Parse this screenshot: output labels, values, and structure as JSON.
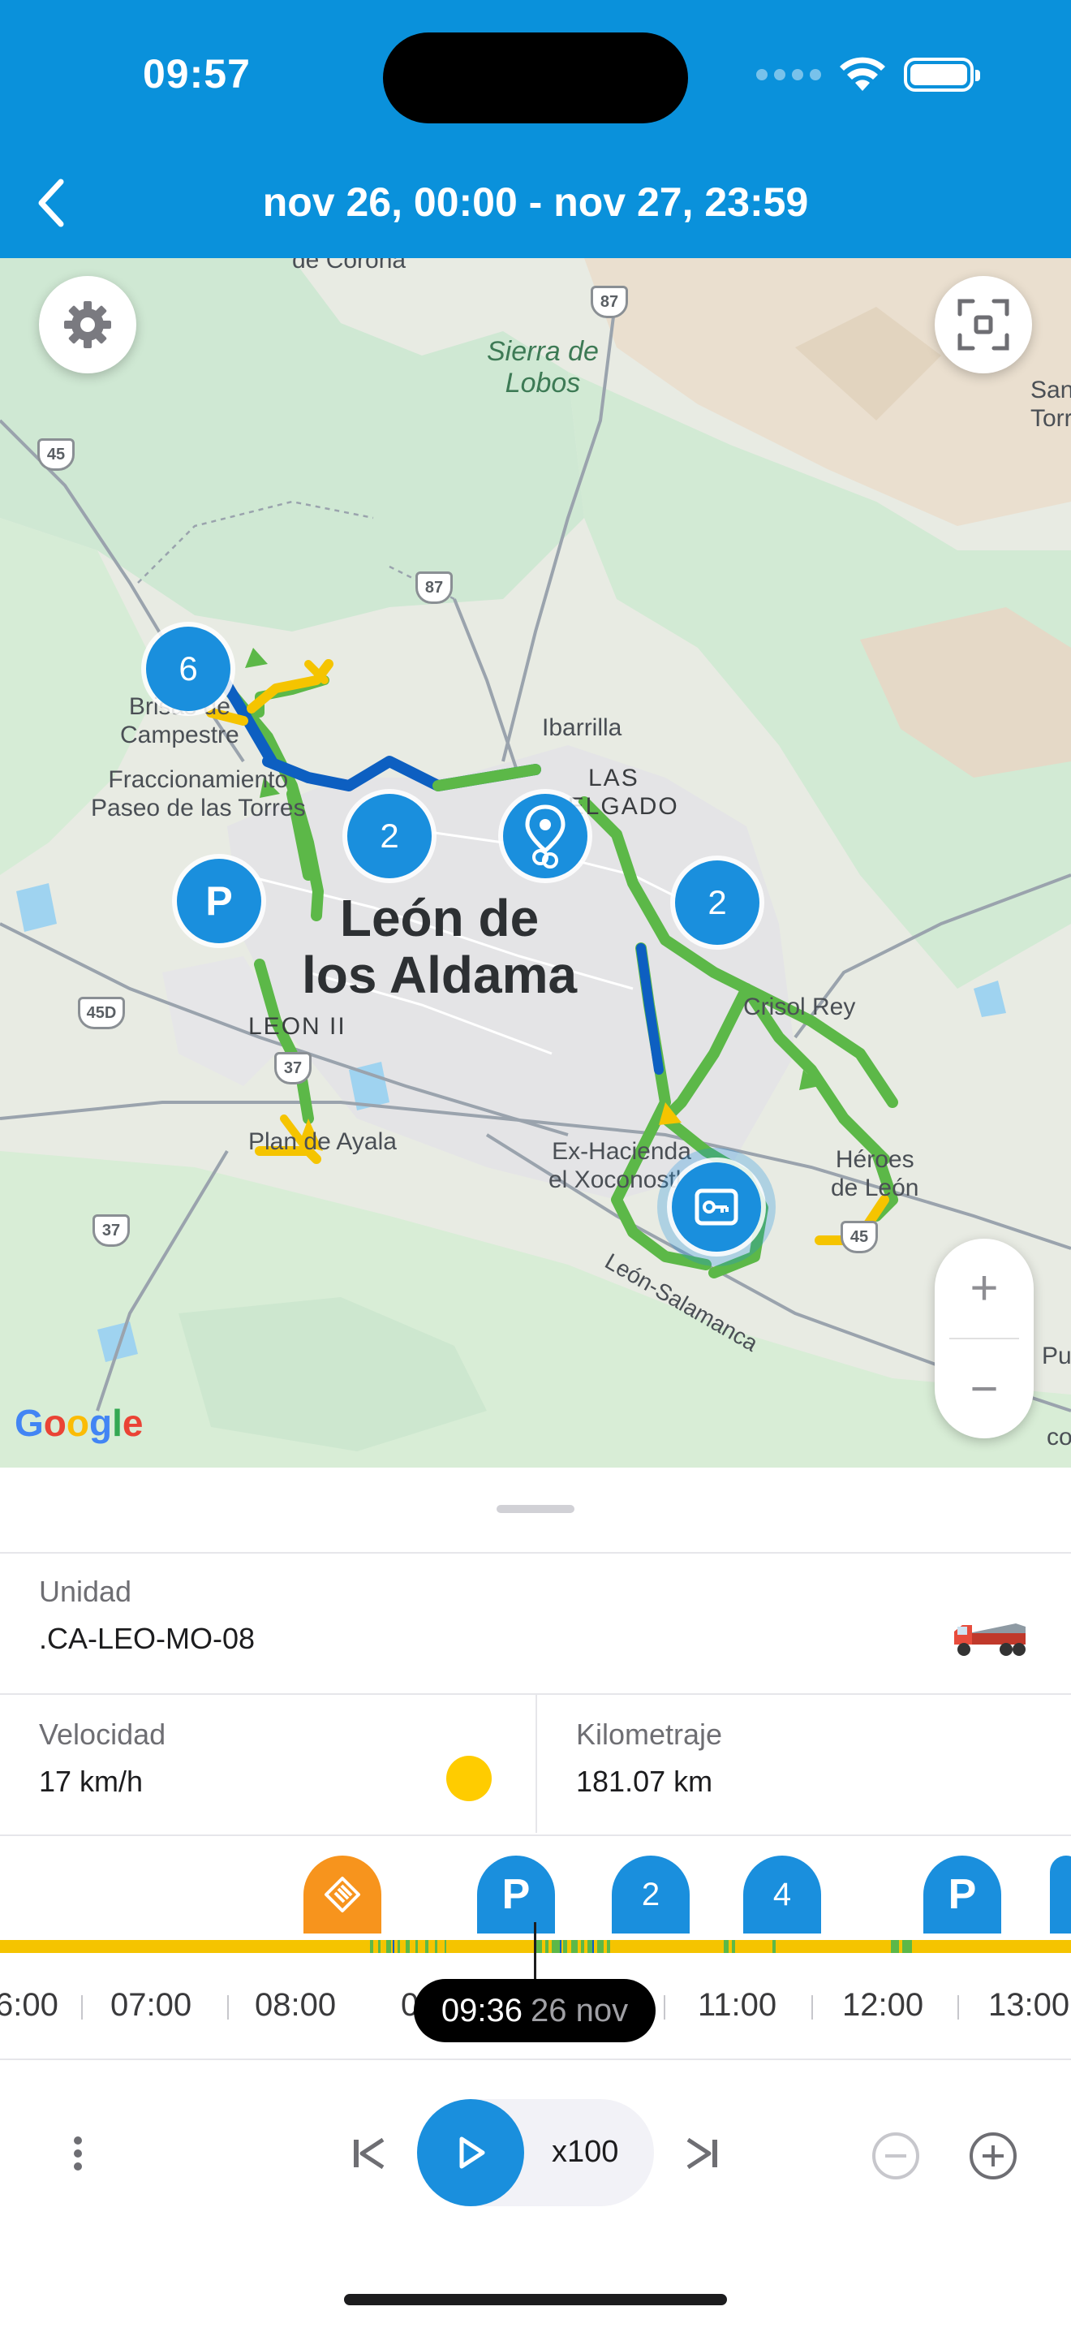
{
  "status_bar": {
    "time": "09:57"
  },
  "header": {
    "title": "nov 26, 00:00 - nov 27, 23:59"
  },
  "map": {
    "labels": {
      "corona": "de Corona",
      "sierra": "Sierra de\nLobos",
      "san_torre": "San\nTorre",
      "brisas": "Brisas de\nCampestre",
      "fraccionamiento": "Fraccionamiento\nPaseo de las Torres",
      "ibarrilla": "Ibarrilla",
      "las_delgado": "LAS\nDELGADO",
      "city": "León de\nlos Aldama",
      "leon_ii": "LEON II",
      "crisol_rey": "Crisol Rey",
      "plan_ayala": "Plan de Ayala",
      "ex_hacienda": "Ex-Hacienda\nel Xoconostle",
      "heroes": "Héroes\nde León",
      "road_leon_salamanca": "León-Salamanca",
      "pu": "Pu",
      "co": "co"
    },
    "shields": [
      "87",
      "45",
      "87",
      "45D",
      "37",
      "37",
      "45"
    ],
    "clusters": [
      "6",
      "2",
      "2"
    ],
    "parking_label": "P",
    "google": "Google"
  },
  "details": {
    "unit_label": "Unidad",
    "unit_value": ".CA-LEO-MO-08",
    "speed_label": "Velocidad",
    "speed_value": "17 km/h",
    "speed_status_color": "#ffcc00",
    "km_label": "Kilometraje",
    "km_value": "181.07 km"
  },
  "timeline": {
    "markers": [
      {
        "type": "event",
        "color": "#f7941d",
        "icon": "tag-icon"
      },
      {
        "type": "parking",
        "label": "P"
      },
      {
        "type": "cluster",
        "label": "2"
      },
      {
        "type": "cluster",
        "label": "4"
      },
      {
        "type": "parking",
        "label": "P"
      }
    ],
    "ticks": [
      "6:00",
      "07:00",
      "08:00",
      "0",
      "11:00",
      "12:00",
      "13:00"
    ],
    "current_time": "09:36",
    "current_date": "26 nov"
  },
  "player": {
    "speed": "x100"
  },
  "colors": {
    "brand": "#0a91db",
    "accent": "#1a8fdd",
    "route_green": "#5cb848",
    "route_yellow": "#f5c400",
    "route_blue": "#0d5fc1"
  }
}
